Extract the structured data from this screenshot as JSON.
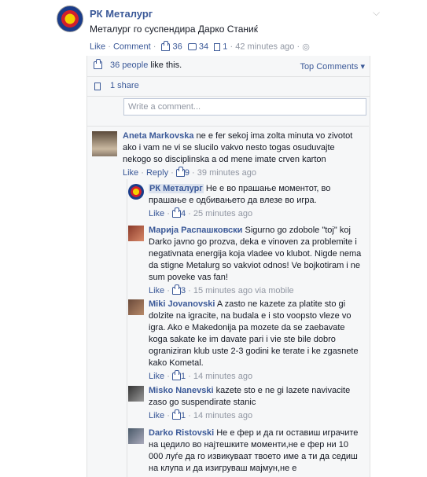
{
  "post": {
    "page_name": "РК Металург",
    "text": "Металург го суспендира Дарко Станиќ",
    "actions": {
      "like": "Like",
      "comment": "Comment",
      "like_count": "36",
      "comment_count": "34",
      "share_count": "1",
      "time": "42 minutes ago",
      "sep": "·"
    }
  },
  "ufi": {
    "likes_people": "36 people",
    "likes_suffix": " like this.",
    "top_comments": "Top Comments ▾",
    "shares": "1 share",
    "write_placeholder": "Write a comment..."
  },
  "comments": [
    {
      "name": "Aneta Markovska",
      "text": " ne e fer sekoj ima zolta minuta vo zivotot ako i vam ne vi se slucilo vakvo nesto togas osuduvajte nekogo so disciplinska a od mene imate crven karton",
      "like": "Like",
      "reply": "Reply",
      "likes": "9",
      "time": "39 minutes ago"
    },
    {
      "name": "РК Металург",
      "text": " Не е во прашање моментот, во прашање е одбивањето да влезе во игра.",
      "like": "Like",
      "likes": "4",
      "time": "25 minutes ago"
    },
    {
      "name": "Марија Распашковски",
      "text": " Sigurno go zdobole \"toj\" koj Darko javno go prozva, deka e vinoven za problemite i negativnata energija koja vladee vo klubot. Nigde nema da stigne Metalurg so vakviot odnos! Ve bojkotiram i ne sum poveke vas fan!",
      "like": "Like",
      "likes": "3",
      "time": "15 minutes ago via mobile"
    },
    {
      "name": "Miki Jovanovski",
      "text": " A zasto ne kazete za platite sto gi dolzite na igracite, na budala e i sto voopsto vlezе vo igra. Ako e Makedonija pa mozete da se zaebavate koga sakate ke im davate pari i vie ste bile dobro ograniziran klub uste 2-3 godini ke terate i ke zgasnete kako Kometal.",
      "like": "Like",
      "likes": "1",
      "time": "14 minutes ago"
    },
    {
      "name": "Misko Nanevski",
      "text": " kazete sto e ne gi lazete navivacite zaso go suspendirate stanic",
      "like": "Like",
      "likes": "1",
      "time": "14 minutes ago"
    },
    {
      "name": "Darko Ristovski",
      "text": " Не е фер и да ги оставиш играчите на цедило во најтешките моменти,не е фер ни 10 000 луѓе да го извикуваат твоето име а ти да седиш на клупа и да изигруваш мајмун,не е"
    }
  ]
}
